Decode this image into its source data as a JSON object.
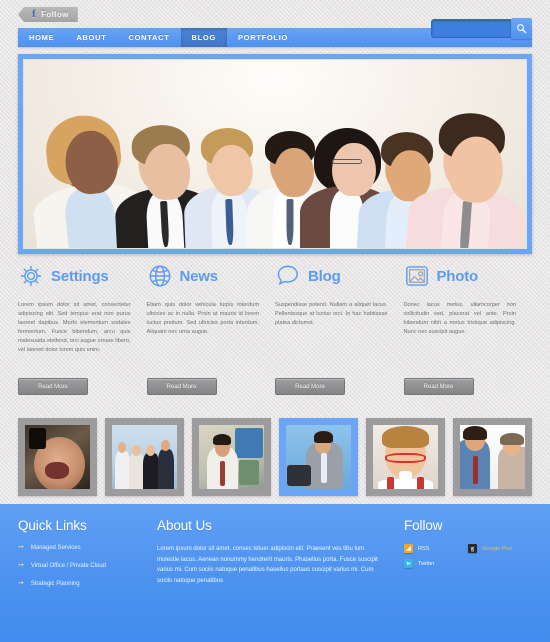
{
  "topbar": {
    "follow_badge": "Follow",
    "facebook_glyph": "f"
  },
  "search": {
    "value": "",
    "placeholder": "",
    "icon": "search-icon"
  },
  "nav": {
    "items": [
      {
        "label": "HOME",
        "active": false
      },
      {
        "label": "ABOUT",
        "active": false
      },
      {
        "label": "CONTACT",
        "active": false
      },
      {
        "label": "BLOG",
        "active": true
      },
      {
        "label": "PORTFOLIO",
        "active": false
      }
    ]
  },
  "hero": {
    "alt": "group of seven smiling business people",
    "border_color": "#6aa6f5"
  },
  "services": {
    "read_more_label": "Read More",
    "items": [
      {
        "icon": "gear-icon",
        "title": "Settings",
        "body": "Lorem ipsum dolor sit amet, consectetur adipiscing elit. Sed tempus erat non purus laoreet dapibus. Morbi elementum sodales fermentum. Fusce bibendum, arcu quis malesuada eleifend, orci augue ornare libero, vel laoreet dolor lorem quis enim."
      },
      {
        "icon": "globe-icon",
        "title": "News",
        "body": "Etiam quis dolor vehicula turpis interdum ultricies ac in nulla. Proin at mauris id lorem luctus pretium. Sed ultricies porta interdum. Aliquam nec urna augue."
      },
      {
        "icon": "speech-bubble-icon",
        "title": "Blog",
        "body": "Suspendisse potenti. Nullam a aliquet lacus. Pellentesque at luctus orci. In hac habitasse platea dictumst."
      },
      {
        "icon": "photo-icon",
        "title": "Photo",
        "body": "Donec lacus metus, ullamcorper non sollicitudin sed, placerat vel ante. Proin bibendum nibh a metus tristique adipiscing. Nunc nec suscipit augue."
      }
    ]
  },
  "gallery": {
    "items": [
      {
        "alt": "bald man shouting close-up",
        "active": false
      },
      {
        "alt": "business team of four posing",
        "active": false
      },
      {
        "alt": "bored man resting head on hands",
        "active": false
      },
      {
        "alt": "man shouting at laptop",
        "active": true
      },
      {
        "alt": "man with red glasses and suspenders",
        "active": false
      },
      {
        "alt": "two men arguing face to face",
        "active": false
      }
    ]
  },
  "footer": {
    "quick_links": {
      "title": "Quick Links",
      "items": [
        "Managed Services",
        "Virtual Office / Private Cloud",
        "Strategic Planning"
      ]
    },
    "about": {
      "title": "About Us",
      "body": "Lorem ipsum dolor sit amet, consec tetuer adipiscin elit. Praesent ves tibu lum molestie lacus. Aenean nonummy hendrerit mauris. Phasellus porta. Fusce suscipit varius mi. Cum sociis natoque penatibus hasellus portaus suscipit varius mi. Cum sociis natoque penatibus"
    },
    "follow": {
      "title": "Follow",
      "socials": [
        {
          "label": "RSS",
          "icon": "rss-icon",
          "glyph": "◤",
          "color": "#f7a32b"
        },
        {
          "label": "Google Plus",
          "icon": "google-plus-icon",
          "glyph": "g",
          "color": "#2b2b2b"
        },
        {
          "label": "Twitter",
          "icon": "twitter-icon",
          "glyph": "t",
          "color": "#38b4e0"
        }
      ]
    }
  },
  "theme": {
    "accent": "#5b9bf0",
    "nav_blue": "#5596f0",
    "footer_blue": "#4d92ef",
    "button_gray": "#8e8e90",
    "page_bg": "#e8e5e6"
  }
}
